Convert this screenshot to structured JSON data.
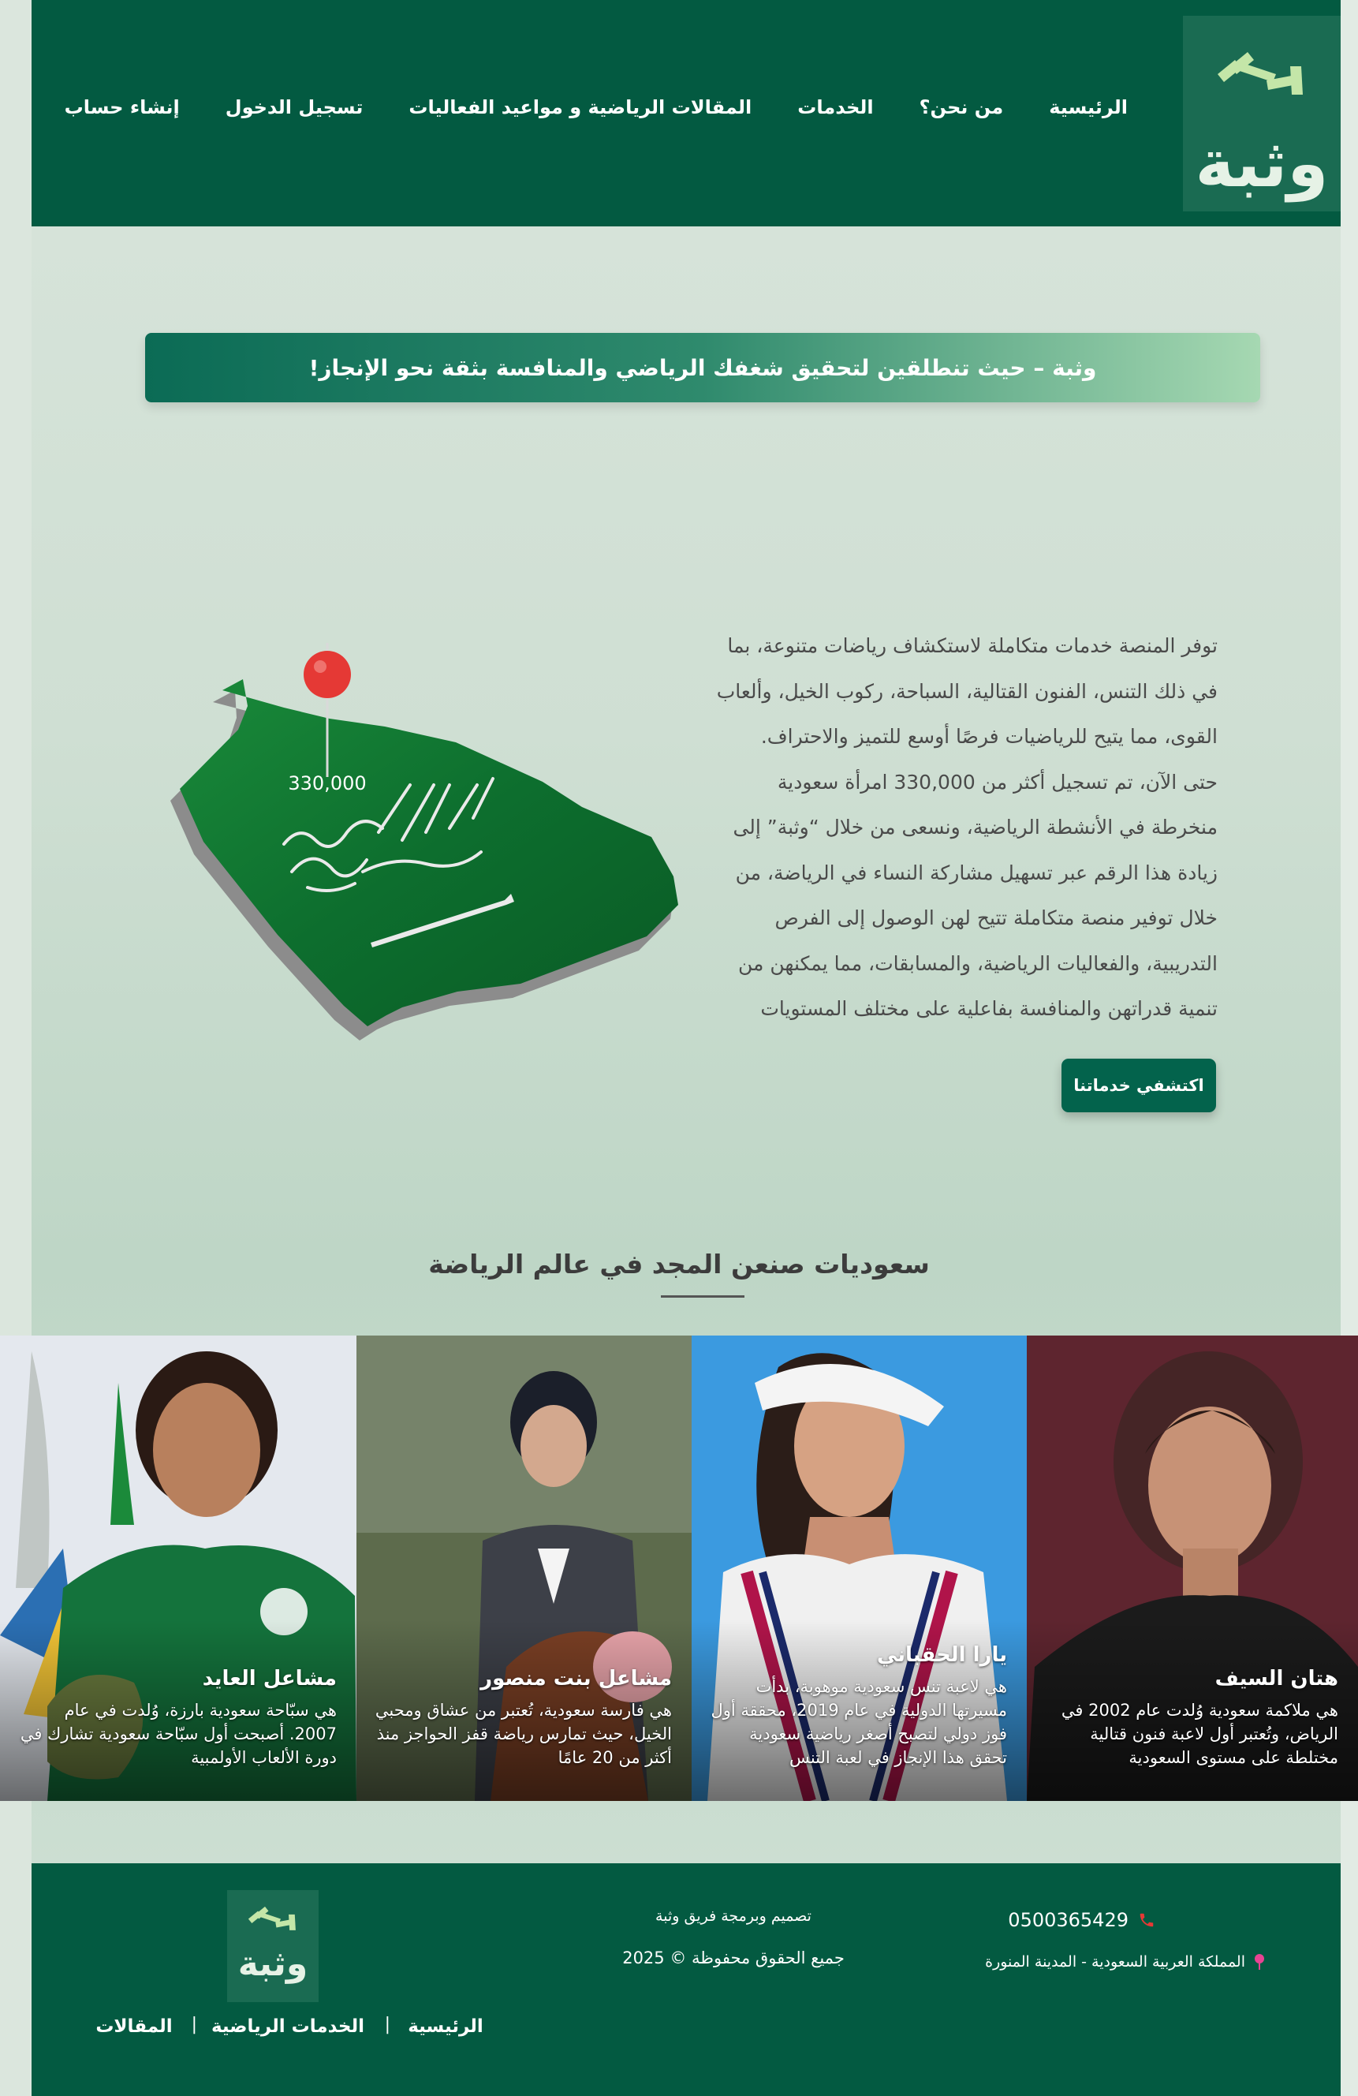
{
  "brand": {
    "name": "وثبة"
  },
  "nav": {
    "items": [
      {
        "label": "الرئيسية"
      },
      {
        "label": "من نحن؟"
      },
      {
        "label": "الخدمات"
      },
      {
        "label": "المقالات الرياضية و مواعيد الفعاليات"
      },
      {
        "label": "تسجيل الدخول"
      },
      {
        "label": "إنشاء حساب"
      }
    ]
  },
  "hero": {
    "tagline": "وثبة – حيث تنطلقين لتحقيق شغفك الرياضي والمنافسة بثقة نحو الإنجاز!"
  },
  "about": {
    "lines": [
      "توفر المنصة خدمات متكاملة لاستكشاف رياضات متنوعة، بما",
      "في ذلك التنس، الفنون القتالية، السباحة، ركوب الخيل، وألعاب",
      "القوى، مما يتيح للرياضيات فرصًا أوسع للتميز والاحتراف.",
      "حتى الآن، تم تسجيل أكثر من 330,000 امرأة سعودية",
      "منخرطة في الأنشطة الرياضية، ونسعى من خلال “وثبة” إلى",
      "زيادة هذا الرقم عبر تسهيل مشاركة النساء في الرياضة، من",
      "خلال توفير منصة متكاملة تتيح لهن الوصول إلى الفرص",
      "التدريبية، والفعاليات الرياضية، والمسابقات، مما يمكنهن من",
      "تنمية قدراتهن والمنافسة بفاعلية على مختلف المستويات"
    ],
    "cta_label": "اكتشفي خدماتنا",
    "map_pin_value": "330,000"
  },
  "athletes": {
    "title": "سعوديات صنعن المجد في عالم الرياضة",
    "items": [
      {
        "name": "هتان السيف",
        "desc": "هي ملاكمة سعودية وُلدت عام 2002 في الرياض، وتُعتبر أول لاعبة فنون قتالية مختلطة على مستوى السعودية"
      },
      {
        "name": "يارا الحقباني",
        "desc": "هي لاعبة تنس سعودية موهوبة، بدأت مسيرتها الدولية في عام 2019، محققة أول فوز دولي لتصبح أصغر رياضية سعودية تحقق هذا الإنجاز في لعبة التنس"
      },
      {
        "name": "مشاعل بنت منصور",
        "desc": "هي فارسة سعودية، تُعتبر من عشاق ومحبي الخيل، حيث تمارس رياضة قفز الحواجز منذ أكثر من 20 عامًا"
      },
      {
        "name": "مشاعل العايد",
        "desc": "هي سبّاحة سعودية بارزة، وُلدت في عام 2007. أصبحت أول سبّاحة سعودية تشارك في دورة الألعاب الأولمبية"
      }
    ]
  },
  "footer": {
    "phone": "0500365429",
    "location": "المملكة العربية السعودية - المدينة المنورة",
    "credit": "تصميم وبرمجة فريق وثبة",
    "rights": "جميع الحقوق محفوظة © 2025",
    "links": [
      {
        "label": "الرئيسية"
      },
      {
        "label": "الخدمات الرياضية"
      },
      {
        "label": "المقالات"
      }
    ],
    "separator": "|"
  },
  "colors": {
    "primary": "#035a41",
    "logo_bg": "#1a6b52",
    "accent_light": "#c4e6a8",
    "pin_red": "#e53935"
  },
  "icons": {
    "brand_mark": "dumbbell-icon",
    "phone": "phone-icon",
    "location": "location-pin-icon"
  }
}
